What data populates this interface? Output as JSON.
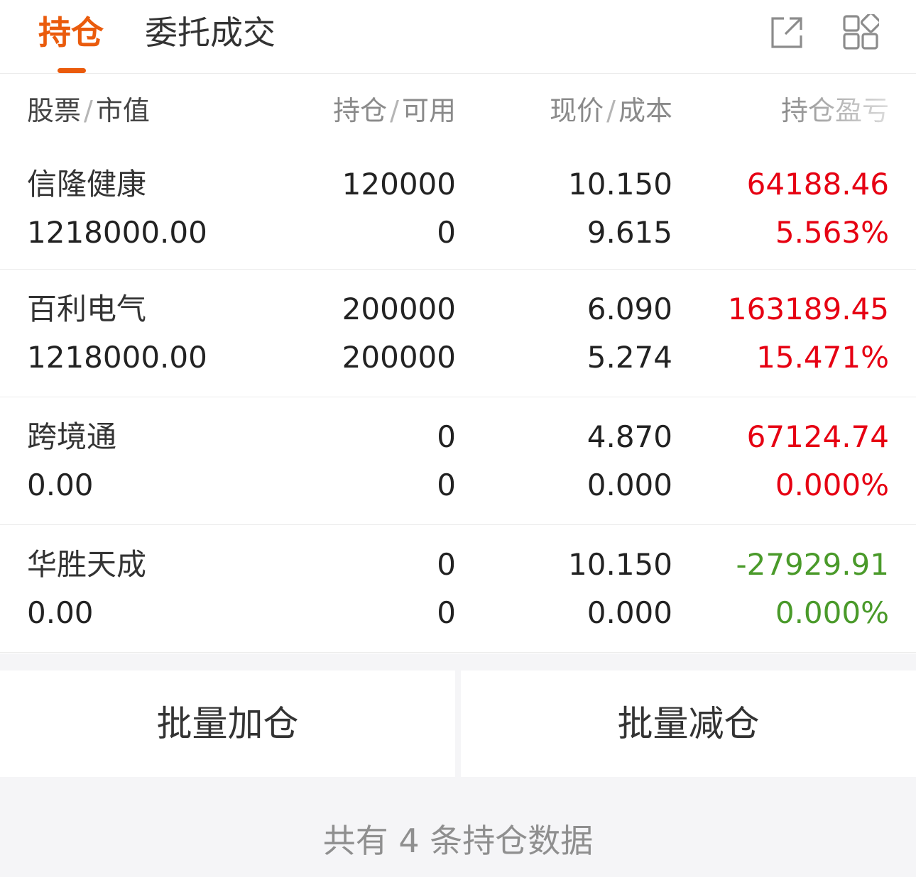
{
  "tabs": {
    "holdings": "持仓",
    "orders": "委托成交"
  },
  "icons": {
    "share": "share-icon",
    "grid": "grid-icon",
    "accent": "#ea5b0c"
  },
  "header": {
    "stock": "股票",
    "market_value": "市值",
    "position": "持仓",
    "available": "可用",
    "price": "现价",
    "cost": "成本",
    "pl": "持仓盈亏"
  },
  "rows": [
    {
      "name": "信隆健康",
      "market_value": "1218000.00",
      "position": "120000",
      "available": "0",
      "price": "10.150",
      "cost": "9.615",
      "pl": "64188.46",
      "pl_pct": "5.563%",
      "trend": "up"
    },
    {
      "name": "百利电气",
      "market_value": "1218000.00",
      "position": "200000",
      "available": "200000",
      "price": "6.090",
      "cost": "5.274",
      "pl": "163189.45",
      "pl_pct": "15.471%",
      "trend": "up"
    },
    {
      "name": "跨境通",
      "market_value": "0.00",
      "position": "0",
      "available": "0",
      "price": "4.870",
      "cost": "0.000",
      "pl": "67124.74",
      "pl_pct": "0.000%",
      "trend": "up"
    },
    {
      "name": "华胜天成",
      "market_value": "0.00",
      "position": "0",
      "available": "0",
      "price": "10.150",
      "cost": "0.000",
      "pl": "-27929.91",
      "pl_pct": "0.000%",
      "trend": "down"
    }
  ],
  "colors": {
    "up": "#e60012",
    "down": "#4a9a2a"
  },
  "buttons": {
    "batch_add": "批量加仓",
    "batch_reduce": "批量减仓"
  },
  "footer": {
    "summary": "共有 4 条持仓数据"
  }
}
